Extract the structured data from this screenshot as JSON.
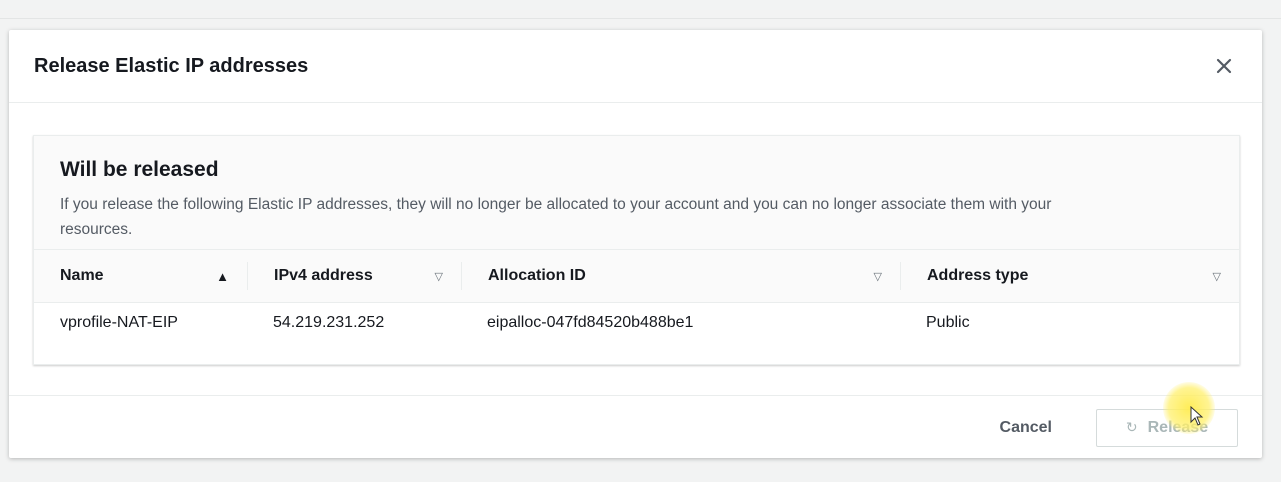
{
  "modal": {
    "title": "Release Elastic IP addresses"
  },
  "panel": {
    "title": "Will be released",
    "description": "If you release the following Elastic IP addresses, they will no longer be allocated to your account and you can no longer associate them with your resources."
  },
  "table": {
    "columns": [
      {
        "label": "Name",
        "sort": "ascending",
        "sort_glyph": "▲"
      },
      {
        "label": "IPv4 address",
        "sort": "none",
        "sort_glyph": "▽"
      },
      {
        "label": "Allocation ID",
        "sort": "none",
        "sort_glyph": "▽"
      },
      {
        "label": "Address type",
        "sort": "none",
        "sort_glyph": "▽"
      }
    ],
    "rows": [
      {
        "name": "vprofile-NAT-EIP",
        "ipv4": "54.219.231.252",
        "allocation_id": "eipalloc-047fd84520b488be1",
        "address_type": "Public"
      }
    ]
  },
  "footer": {
    "cancel_label": "Cancel",
    "release_label": "Release",
    "release_state": "loading"
  },
  "icons": {
    "close": "close-icon",
    "spinner": "spinner-icon"
  },
  "colors": {
    "text": "#16191f",
    "secondary_text": "#545b64",
    "disabled_text": "#aab7b8",
    "border": "#eaeded"
  }
}
